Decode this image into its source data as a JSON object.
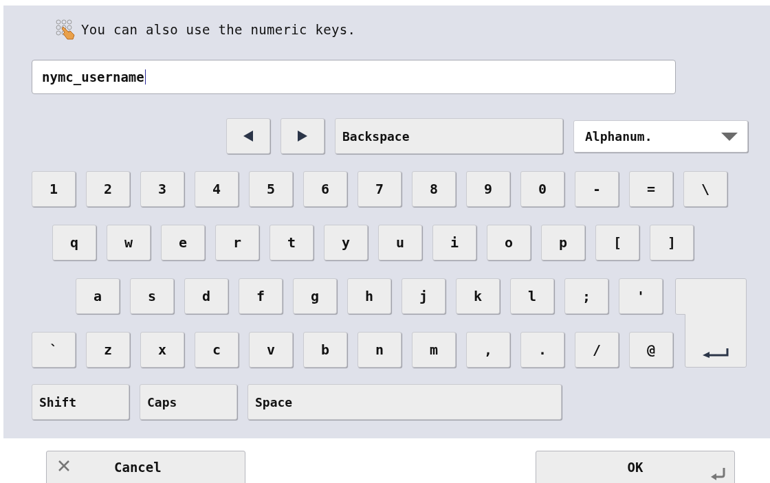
{
  "hint": "You can also use the numeric keys.",
  "input": {
    "value": "nymc_username"
  },
  "nav": {
    "backspace": "Backspace",
    "mode": "Alphanum."
  },
  "key_rows": [
    [
      "1",
      "2",
      "3",
      "4",
      "5",
      "6",
      "7",
      "8",
      "9",
      "0",
      "-",
      "=",
      "\\"
    ],
    [
      "q",
      "w",
      "e",
      "r",
      "t",
      "y",
      "u",
      "i",
      "o",
      "p",
      "[",
      "]"
    ],
    [
      "a",
      "s",
      "d",
      "f",
      "g",
      "h",
      "j",
      "k",
      "l",
      ";",
      "'"
    ],
    [
      "`",
      "z",
      "x",
      "c",
      "v",
      "b",
      "n",
      "m",
      ",",
      ".",
      "/",
      "@"
    ]
  ],
  "bottom_keys": [
    "Shift",
    "Caps",
    "Space"
  ],
  "footer": {
    "cancel": "Cancel",
    "ok": "OK"
  }
}
